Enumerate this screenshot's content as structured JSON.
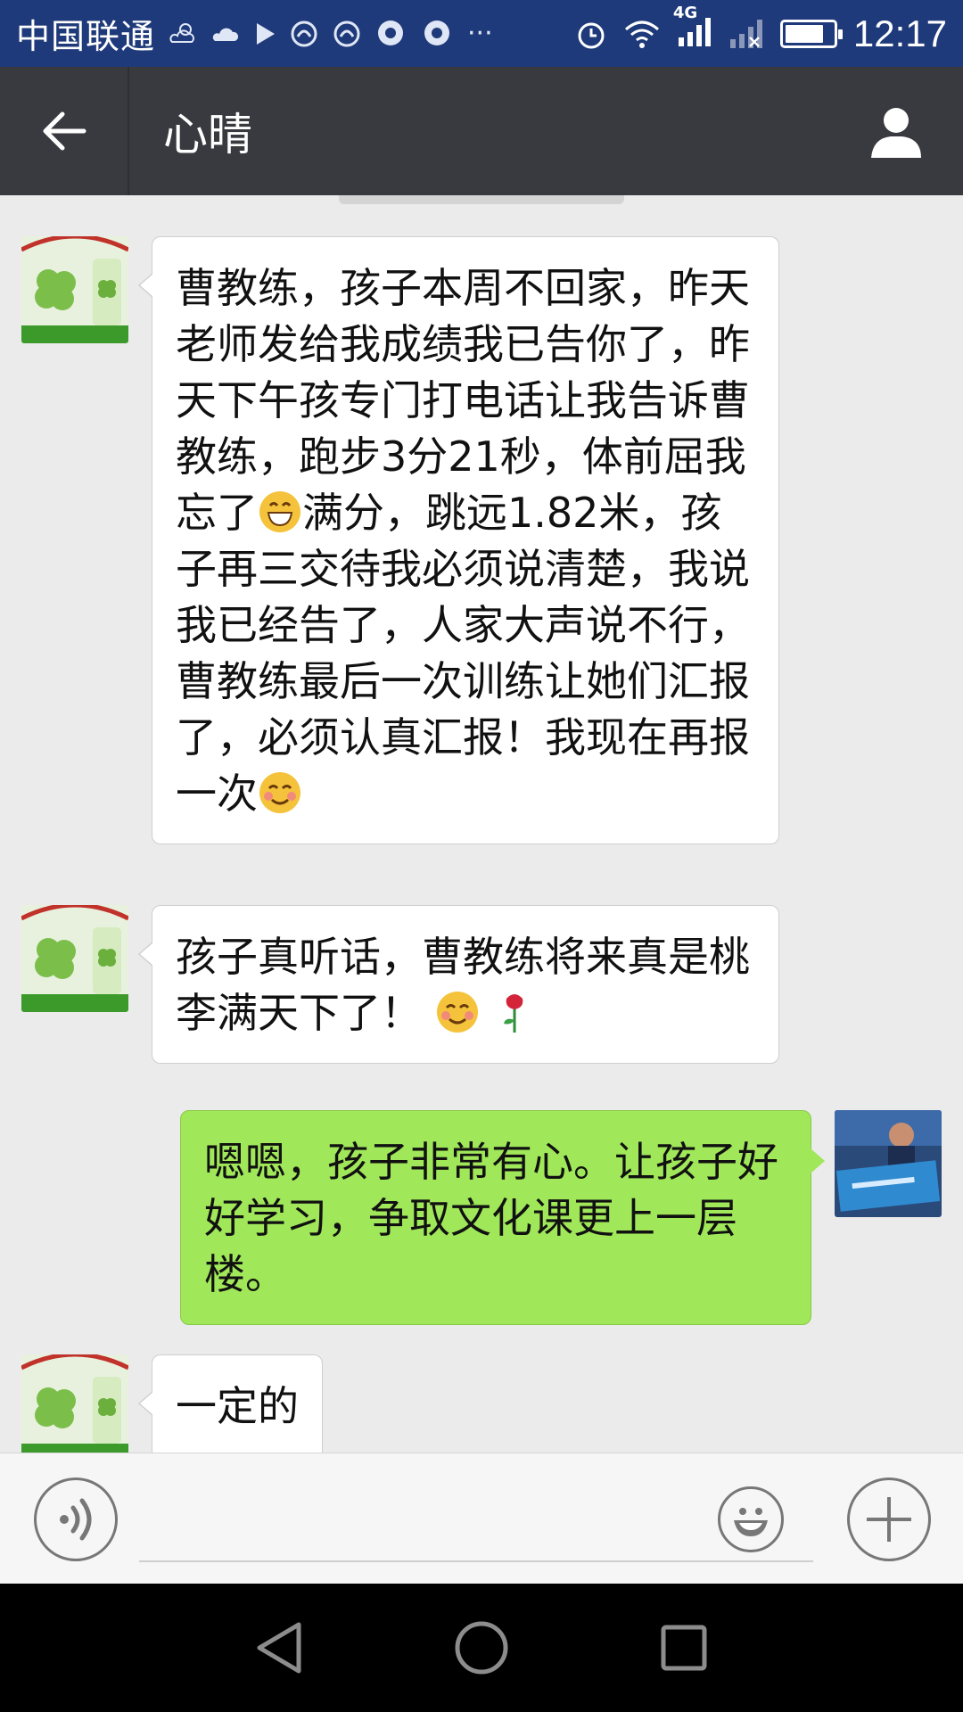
{
  "status_bar": {
    "carrier": "中国联通",
    "network": "4G",
    "time": "12:17",
    "battery_percent": 80,
    "more": "···"
  },
  "header": {
    "title": "心晴",
    "back_icon": "arrow-left-icon",
    "profile_icon": "person-icon"
  },
  "messages": [
    {
      "side": "in",
      "avatar": "clover-avatar",
      "text_parts": [
        "曹教练，孩子本周不回家，昨天老师发给我成绩我已告你了，昨天下午孩专门打电话让我告诉曹教练，跑步3分21秒，体前屈我忘了",
        "满分，跳远1.82米，孩子再三交待我必须说清楚，我说我已经告了，人家大声说不行，曹教练最后一次训练让她们汇报了，必须认真汇报！我现在再报一次"
      ]
    },
    {
      "side": "in",
      "avatar": "clover-avatar",
      "text": "孩子真听话，曹教练将来真是桃李满天下了！"
    },
    {
      "side": "out",
      "avatar": "runner-avatar",
      "text": "嗯嗯，孩子非常有心。让孩子好好学习，争取文化课更上一层楼。"
    },
    {
      "side": "in",
      "avatar": "clover-avatar",
      "text": "一定的"
    }
  ],
  "input_bar": {
    "voice_icon": "voice-icon",
    "emoji_icon": "emoji-icon",
    "plus_icon": "plus-icon"
  },
  "colors": {
    "status_bar": "#1f3a7a",
    "header": "#393a3f",
    "chat_bg": "#ebebeb",
    "bubble_in": "#ffffff",
    "bubble_out": "#a0e759"
  }
}
